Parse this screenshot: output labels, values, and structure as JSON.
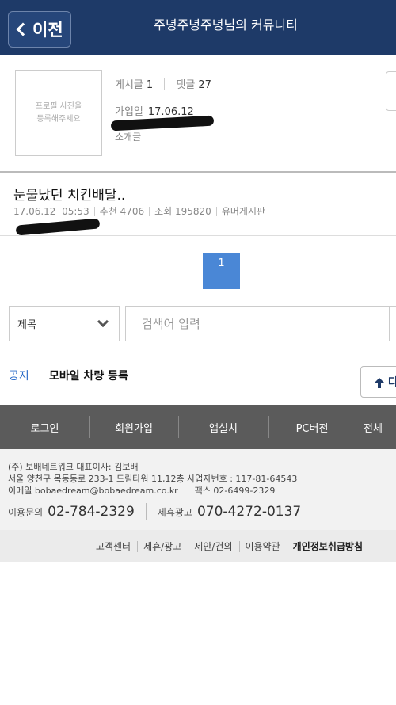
{
  "header": {
    "back_label": "이전",
    "title": "주녕주녕주녕님의 커뮤니티"
  },
  "profile": {
    "photo_placeholder": "프로필 사진을 등록해주세요",
    "posts_label": "게시글",
    "posts_count": "1",
    "comments_label": "댓글",
    "comments_count": "27",
    "joined_label": "가입일",
    "joined_date": "17.06.12",
    "intro_label": "소개글"
  },
  "post": {
    "title": "눈물났던 치킨배달..",
    "date": "17.06.12",
    "time": "05:53",
    "recommend": "추천 4706",
    "views": "조회 195820",
    "board": "유머게시판"
  },
  "pagination": {
    "current": "1"
  },
  "search": {
    "field_selected": "제목",
    "placeholder": "검색어 입력"
  },
  "notice": {
    "tag": "공지",
    "text": "모바일 차량 등록",
    "write_label": "다"
  },
  "footer_nav": [
    "로그인",
    "회원가입",
    "앱설치",
    "PC버전",
    "전체"
  ],
  "footer_info": {
    "line1": "(주) 보배네트워크 대표이사: 김보배",
    "line2": "서울 양천구 목동동로 233-1 드림타워 11,12층 사업자번호 : 117-81-64543",
    "line3": "이메일 bobaedream@bobaedream.co.kr      팩스 02-6499-2329",
    "contact_label": "이용문의",
    "contact_number": "02-784-2329",
    "ad_label": "제휴광고",
    "ad_number": "070-4272-0137"
  },
  "footer_links": [
    "고객센터",
    "제휴/광고",
    "제안/건의",
    "이용약관",
    "개인정보취급방침"
  ],
  "colors": {
    "header_bg": "#1e3a68",
    "accent_blue": "#4a87d6",
    "footer_nav_bg": "#5b5b5b"
  }
}
